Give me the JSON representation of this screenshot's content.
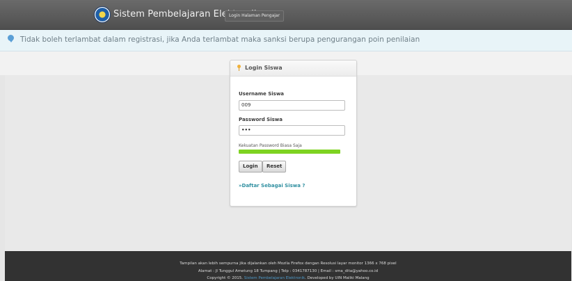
{
  "header": {
    "app_title": "Sistem Pembelajaran Elektronik",
    "teacher_login_link": "Login Halaman Pengajar"
  },
  "notice": {
    "icon": "info-icon",
    "text": "Tidak boleh terlambat dalam registrasi, jika Anda terlambat maka sanksi berupa pengurangan poin penilaian"
  },
  "login": {
    "title": "Login Siswa",
    "title_icon": "key-icon",
    "username_label": "Username Siswa",
    "username_value": "009",
    "password_label": "Password Siswa",
    "password_value": "•••",
    "strength_label": "Kekuatan Password Biasa Saja",
    "strength_level": 1.0,
    "strength_color": "#7ed321",
    "login_button": "Login",
    "reset_button": "Reset",
    "register_link": "»Daftar Sebagai Siswa ?"
  },
  "footer": {
    "line1": "Tampilan akan lebih sempurna jika dijalankan oleh Mozila Firefox dengan Resolusi layar monitor 1366 x 768 pixel",
    "line2": "Alamat : Jl Tunggul Ametung 18 Tumpang | Telp : 0341787130 | Email : sma_dita@yahoo.co.id",
    "line3_prefix": "Copyright © 2015.",
    "line3_accent": "Sistem Pembelajaran Elektronik",
    "line3_suffix": ". Developed by UIN Maliki Malang"
  },
  "colors": {
    "header_bg": "#5a5a5a",
    "notice_bg": "#e8f4f8",
    "accent_link": "#2f8fa0",
    "footer_bg": "#323232"
  }
}
